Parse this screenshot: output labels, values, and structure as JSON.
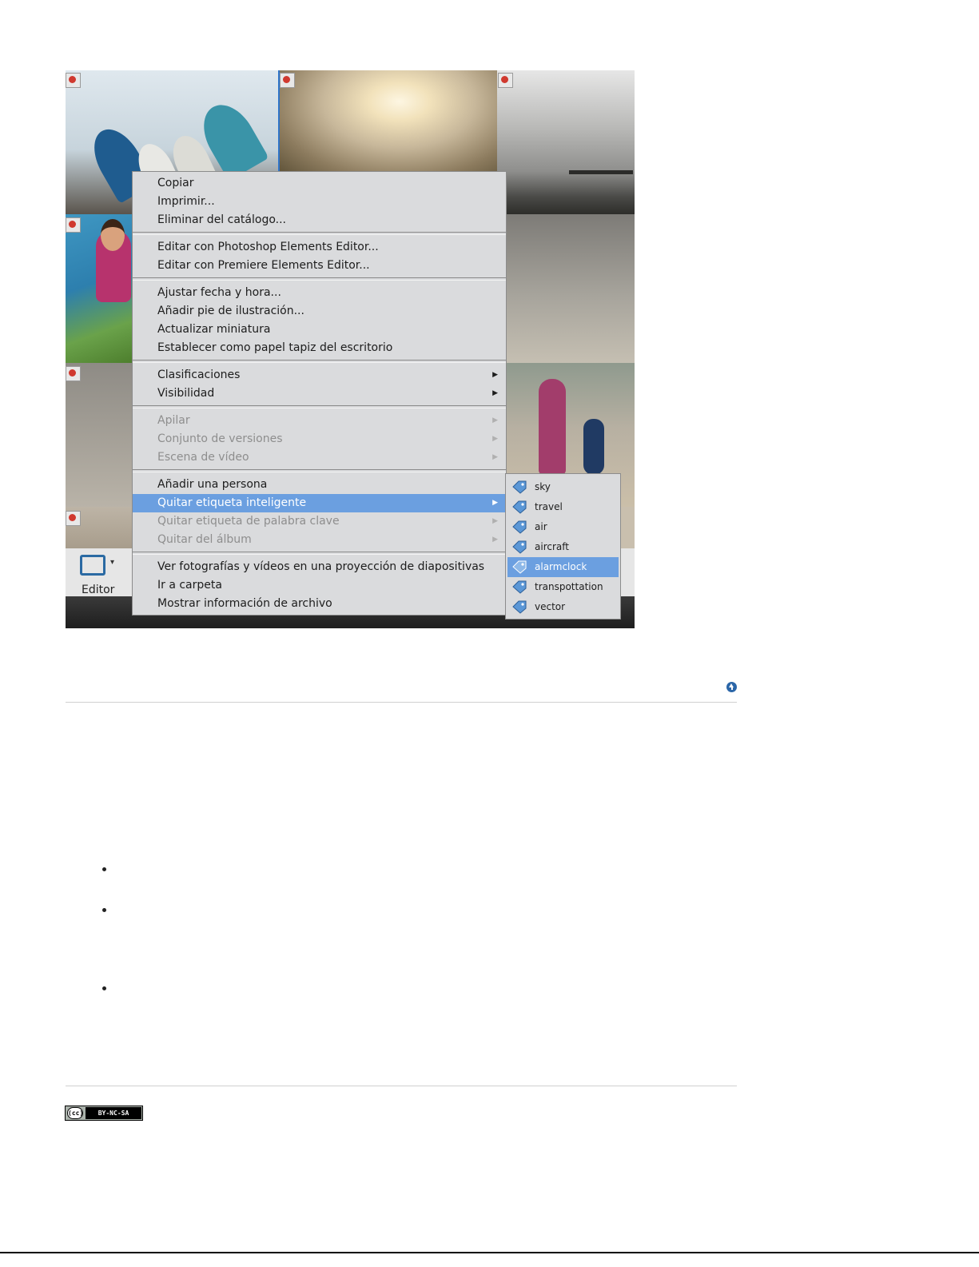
{
  "toolbar": {
    "editor_label": "Editor",
    "dropdown_glyph": "▾"
  },
  "context_menu": {
    "items": [
      {
        "label": "Copiar"
      },
      {
        "label": "Imprimir..."
      },
      {
        "label": "Eliminar del catálogo..."
      },
      {
        "label": "Editar con Photoshop Elements Editor..."
      },
      {
        "label": "Editar con Premiere Elements Editor..."
      },
      {
        "label": "Ajustar fecha y hora..."
      },
      {
        "label": "Añadir pie de ilustración..."
      },
      {
        "label": "Actualizar miniatura"
      },
      {
        "label": "Establecer como papel tapiz del escritorio"
      },
      {
        "label": "Clasificaciones",
        "submenu": true
      },
      {
        "label": "Visibilidad",
        "submenu": true
      },
      {
        "label": "Apilar",
        "submenu": true,
        "disabled": true
      },
      {
        "label": "Conjunto de versiones",
        "submenu": true,
        "disabled": true
      },
      {
        "label": "Escena de vídeo",
        "submenu": true,
        "disabled": true
      },
      {
        "label": "Añadir una persona"
      },
      {
        "label": "Quitar etiqueta inteligente",
        "submenu": true,
        "highlighted": true
      },
      {
        "label": "Quitar etiqueta de palabra clave",
        "submenu": true,
        "disabled": true
      },
      {
        "label": "Quitar del álbum",
        "submenu": true,
        "disabled": true
      },
      {
        "label": "Ver fotografías y vídeos en una proyección de diapositivas"
      },
      {
        "label": "Ir a carpeta"
      },
      {
        "label": "Mostrar información de archivo"
      }
    ],
    "submenu_arrow": "▶"
  },
  "smart_tags": {
    "icon": "smart-tag-icon",
    "items": [
      {
        "label": "sky"
      },
      {
        "label": "travel"
      },
      {
        "label": "air"
      },
      {
        "label": "aircraft"
      },
      {
        "label": "alarmclock",
        "highlighted": true
      },
      {
        "label": "transpottation"
      },
      {
        "label": "vector"
      }
    ]
  },
  "license": {
    "cc_logo": "(cc)",
    "cc_text": "BY-NC-SA"
  },
  "colors": {
    "highlight": "#6b9fe0",
    "menu_bg": "#dadbdd",
    "back_to_top": "#2b66a8"
  }
}
